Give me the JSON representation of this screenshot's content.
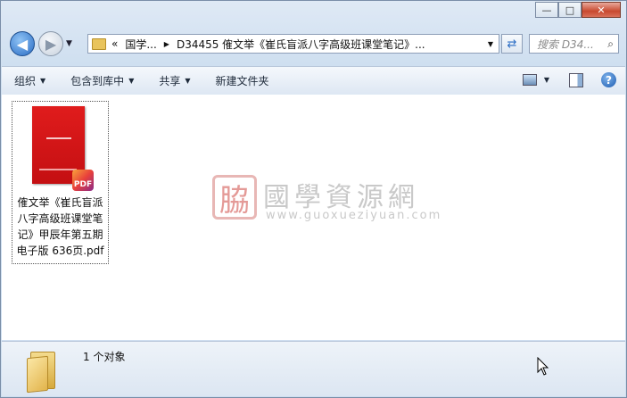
{
  "window": {
    "controls": {
      "minimize": "—",
      "maximize": "□",
      "close": "✕"
    }
  },
  "address_bar": {
    "overflow": "«",
    "segments": [
      "国学...",
      "D34455 傕文举《崔氏盲派八字高级班课堂笔记》..."
    ],
    "search_placeholder": "搜索 D34..."
  },
  "toolbar": {
    "organize": "组织",
    "include_in_library": "包含到库中",
    "share": "共享",
    "new_folder": "新建文件夹"
  },
  "file": {
    "name": "傕文举《崔氏盲派八字高级班课堂笔记》甲辰年第五期电子版 636页.pdf",
    "badge": "PDF"
  },
  "watermark": {
    "seal": "脇",
    "title": "國學資源網",
    "url": "www.guoxueziyuan.com"
  },
  "status": {
    "count": "1 个对象"
  },
  "icons": {
    "back": "back-arrow-icon",
    "forward": "forward-arrow-icon",
    "refresh": "refresh-icon",
    "search": "search-icon",
    "help": "help-icon"
  }
}
